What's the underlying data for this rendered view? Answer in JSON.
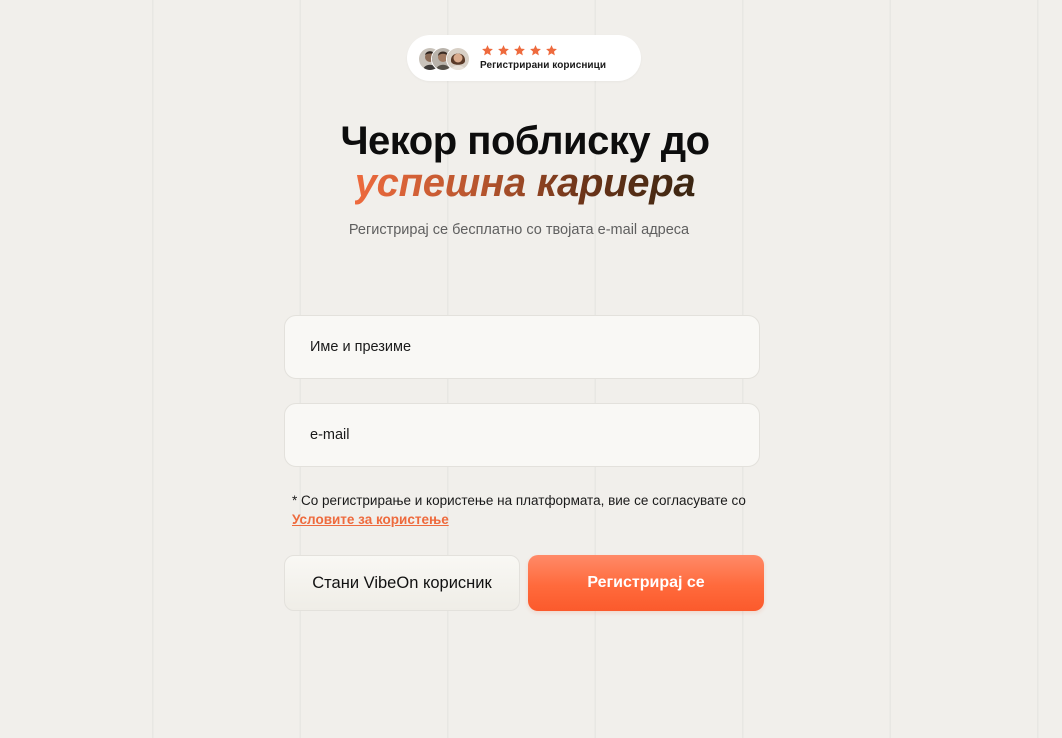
{
  "badge": {
    "rating_stars": 5,
    "label": "Регистрирани корисници",
    "star_color": "#ee6a3d"
  },
  "heading": {
    "line1": "Чекор поблиску до",
    "line2": "успешна кариера",
    "accent_gradient": [
      "#ee6a3d",
      "#b4542d",
      "#6a3318",
      "#3a2612"
    ]
  },
  "subtitle": "Регистрирај се бесплатно со твојата e-mail адреса",
  "form": {
    "name_placeholder": "Име и презиме",
    "email_placeholder": "e-mail",
    "terms_text": "* Со регистрирање и користење на платформата, вие се согласувате со",
    "terms_link": "Условите за користење",
    "secondary_button": "Стани VibeOn корисник",
    "primary_button": "Регистрирај се"
  },
  "colors": {
    "background": "#f1efeb",
    "accent": "#ff6a3c",
    "link": "#ee6a3d"
  },
  "icons": [
    "avatar-icon",
    "star-icon"
  ]
}
